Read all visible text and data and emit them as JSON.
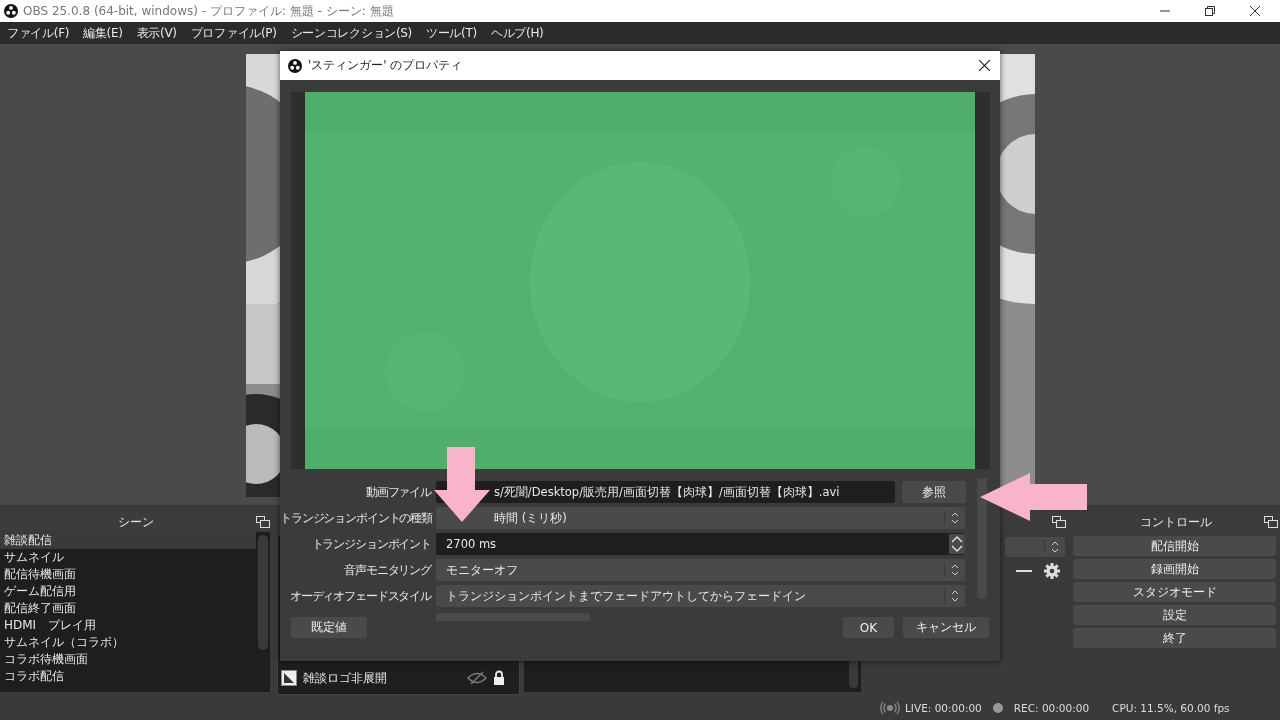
{
  "window": {
    "title": "OBS 25.0.8 (64-bit, windows) - プロファイル: 無題 - シーン: 無題"
  },
  "menu": [
    "ファイル(F)",
    "編集(E)",
    "表示(V)",
    "プロファイル(P)",
    "シーンコレクション(S)",
    "ツール(T)",
    "ヘルプ(H)"
  ],
  "scenes": {
    "title": "シーン",
    "items": [
      {
        "label": "雑談配信",
        "selected": true
      },
      {
        "label": "サムネイル",
        "selected": false
      },
      {
        "label": "配信待機画面",
        "selected": false
      },
      {
        "label": "ゲーム配信用",
        "selected": false
      },
      {
        "label": "配信終了画面",
        "selected": false
      },
      {
        "label": "HDMI　プレイ用",
        "selected": false
      },
      {
        "label": "サムネイル（コラボ）",
        "selected": false
      },
      {
        "label": "コラボ待機画面",
        "selected": false
      },
      {
        "label": "コラボ配信",
        "selected": false
      }
    ]
  },
  "sources": {
    "items": [
      {
        "label": "雑談ロゴ非展開",
        "visible": false,
        "locked": true
      }
    ]
  },
  "controls": {
    "title": "コントロール",
    "buttons": [
      "配信開始",
      "録画開始",
      "スタジオモード",
      "設定",
      "終了"
    ]
  },
  "status_bar": {
    "live": "LIVE: 00:00:00",
    "rec": "REC: 00:00:00",
    "cpu": "CPU: 11.5%, 60.00 fps"
  },
  "dialog": {
    "title": "'スティンガー' のプロパティ",
    "fields": [
      {
        "kind": "file",
        "label": "動画ファイル",
        "value": "s/死闇/Desktop/販売用/画面切替【肉球】/画面切替【肉球】.avi",
        "button": "参照"
      },
      {
        "kind": "select",
        "label": "トランジションポイントの種類",
        "value": "時間 (ミリ秒)"
      },
      {
        "kind": "spin",
        "label": "トランジションポイント",
        "value": "2700 ms"
      },
      {
        "kind": "select",
        "label": "音声モニタリング",
        "value": "モニターオフ"
      },
      {
        "kind": "select",
        "label": "オーディオフェードスタイル",
        "value": "トランジションポイントまでフェードアウトしてからフェードイン"
      }
    ],
    "defaults_button": "既定値",
    "ok_button": "OK",
    "cancel_button": "キャンセル"
  }
}
